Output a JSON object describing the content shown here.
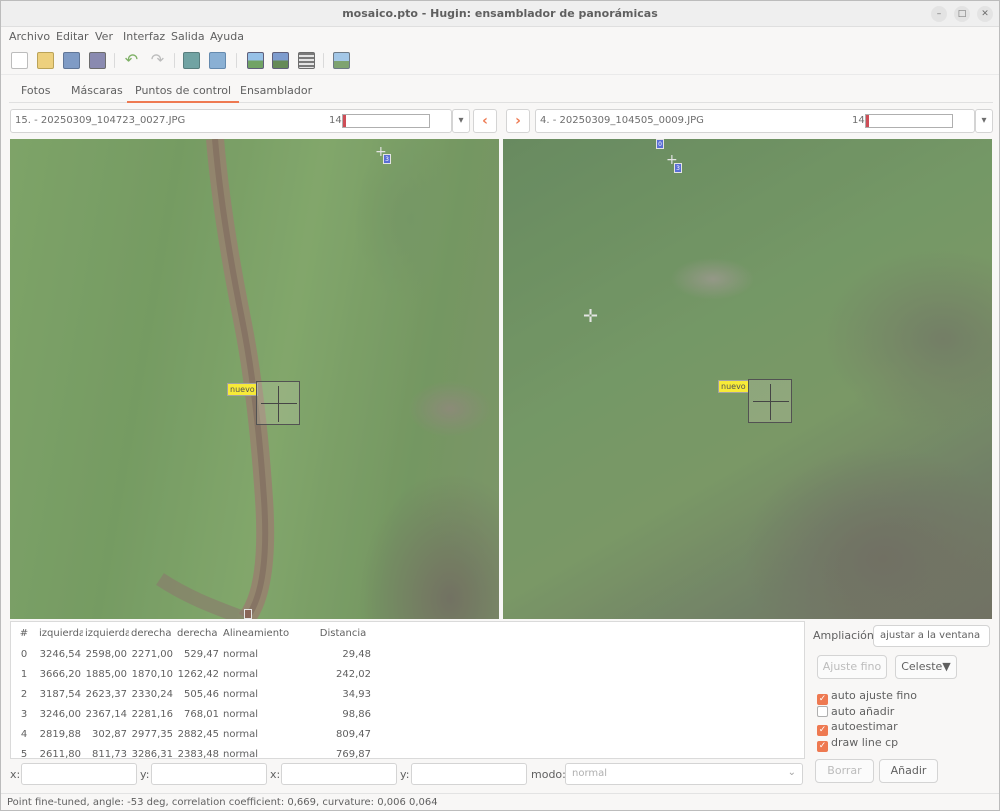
{
  "window": {
    "title": "mosaico.pto - Hugin: ensamblador de panorámicas"
  },
  "menu": [
    "Archivo",
    "Editar",
    "Ver",
    "Interfaz",
    "Salida",
    "Ayuda"
  ],
  "tabs": [
    {
      "label": "Fotos",
      "active": false
    },
    {
      "label": "Máscaras",
      "active": false
    },
    {
      "label": "Puntos de control",
      "active": true
    },
    {
      "label": "Ensamblador",
      "active": false
    }
  ],
  "left_image": {
    "name": "15. - 20250309_104723_0027.JPG",
    "count": "14",
    "fill": 0.03
  },
  "right_image": {
    "name": "4. - 20250309_104505_0009.JPG",
    "count": "14",
    "fill": 0.03
  },
  "nav": {
    "prev": "‹",
    "next": "›"
  },
  "cp_label": "nuevo",
  "markers": {
    "left": "3",
    "right_top": "0",
    "right_mid": "3"
  },
  "table": {
    "headers": [
      "#",
      "izquierda",
      "izquierda",
      "derecha",
      "derecha",
      "Alineamiento",
      "Distancia"
    ],
    "rows": [
      [
        "0",
        "3246,54",
        "2598,00",
        "2271,00",
        "529,47",
        "normal",
        "29,48"
      ],
      [
        "1",
        "3666,20",
        "1885,00",
        "1870,10",
        "1262,42",
        "normal",
        "242,02"
      ],
      [
        "2",
        "3187,54",
        "2623,37",
        "2330,24",
        "505,46",
        "normal",
        "34,93"
      ],
      [
        "3",
        "3246,00",
        "2367,14",
        "2281,16",
        "768,01",
        "normal",
        "98,86"
      ],
      [
        "4",
        "2819,88",
        "302,87",
        "2977,35",
        "2882,45",
        "normal",
        "809,47"
      ],
      [
        "5",
        "2611,80",
        "811,73",
        "3286,31",
        "2383,48",
        "normal",
        "769,87"
      ]
    ]
  },
  "side": {
    "zoom_label": "Ampliación:",
    "zoom_value": "ajustar a la ventana",
    "fine_tune": "Ajuste fino",
    "celeste": "Celeste▼",
    "checks": [
      {
        "label": "auto ajuste fino",
        "checked": true
      },
      {
        "label": "auto añadir",
        "checked": false
      },
      {
        "label": "autoestimar",
        "checked": true
      },
      {
        "label": "draw line cp",
        "checked": true
      }
    ],
    "delete": "Borrar",
    "add": "Añadir"
  },
  "fields": {
    "x1": "x:",
    "y1": "y:",
    "x2": "x:",
    "y2": "y:",
    "mode_label": "modo:",
    "mode_value": "normal"
  },
  "status": "Point fine-tuned, angle: -53 deg, correlation coefficient: 0,669, curvature: 0,006 0,064",
  "colors": {
    "accent": "#e95420",
    "progress": "#c01c28",
    "cp_label": "#f5e400"
  }
}
